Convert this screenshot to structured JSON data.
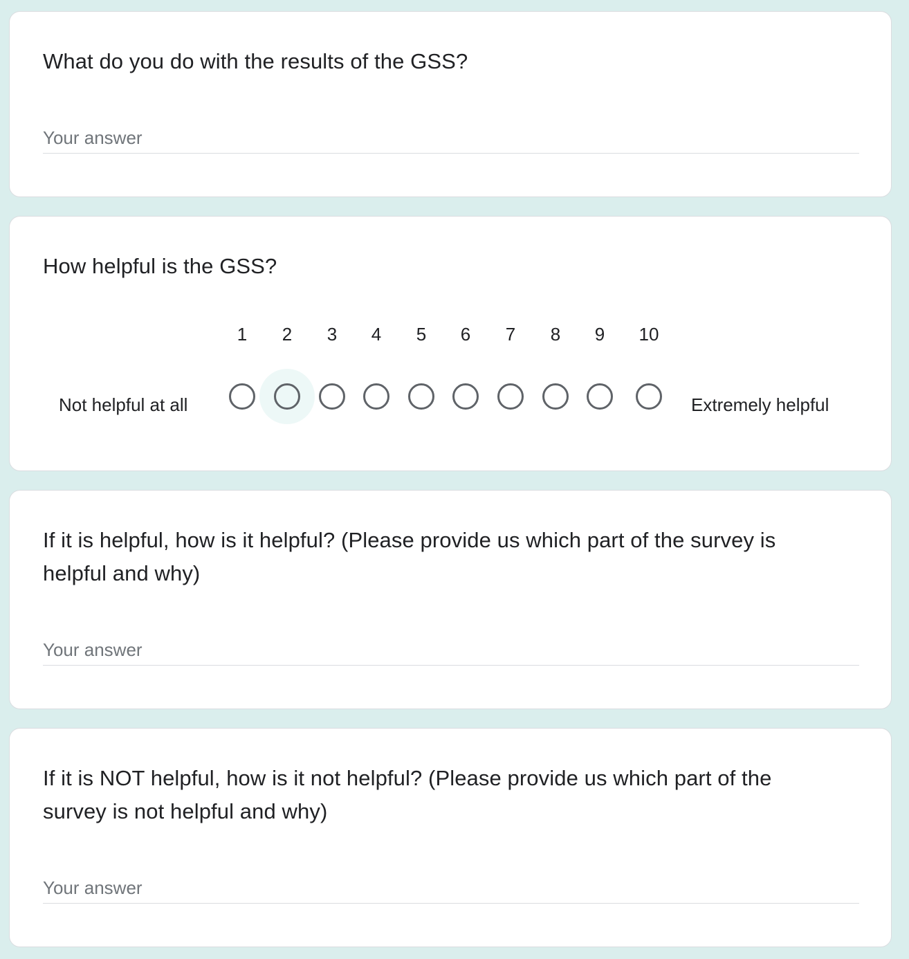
{
  "questions": {
    "results": {
      "title": "What do you do with the results of the GSS?",
      "placeholder": "Your answer"
    },
    "helpfulness": {
      "title": "How helpful is the GSS?",
      "scale": [
        "1",
        "2",
        "3",
        "4",
        "5",
        "6",
        "7",
        "8",
        "9",
        "10"
      ],
      "low_label": "Not helpful at all",
      "high_label": "Extremely helpful",
      "selected": null
    },
    "helpful_how": {
      "title": "If it is helpful, how is it helpful? (Please provide us which part of the survey is helpful and why)",
      "placeholder": "Your answer"
    },
    "not_helpful_how": {
      "title": "If it is NOT helpful, how is it not helpful? (Please provide us which part of the survey is not helpful and why)",
      "placeholder": "Your answer"
    }
  },
  "colors": {
    "page_background": "#daeeed",
    "card_background": "#ffffff",
    "radio_border": "#5f6368",
    "placeholder": "#70757a"
  }
}
